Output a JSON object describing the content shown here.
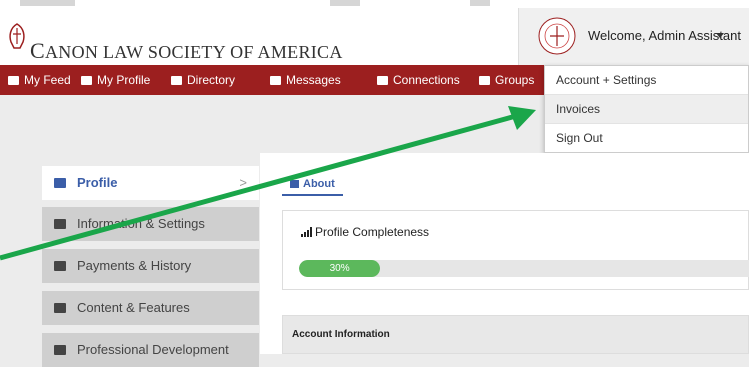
{
  "header": {
    "logo_text_first": "C",
    "logo_text_rest": "ANON LAW SOCIETY OF AMERICA",
    "welcome": "Welcome, Admin Assistant"
  },
  "nav": {
    "items": [
      "My Feed",
      "My Profile",
      "Directory",
      "Messages",
      "Connections",
      "Groups"
    ]
  },
  "user_menu": {
    "items": [
      "Account + Settings",
      "Invoices",
      "Sign Out"
    ]
  },
  "sidebar": {
    "items": [
      "Profile",
      "Information & Settings",
      "Payments & History",
      "Content & Features",
      "Professional Development"
    ],
    "chevron": ">"
  },
  "main": {
    "tab": "About",
    "completeness_title": "Profile Completeness",
    "progress_label": "30%",
    "progress_value": 0.3,
    "account_info": "Account Information"
  },
  "colors": {
    "navbar": "#9c1f1f",
    "accent": "#3b5ea8",
    "progress": "#5cb85c",
    "annotation_arrow": "#1aa64a"
  }
}
